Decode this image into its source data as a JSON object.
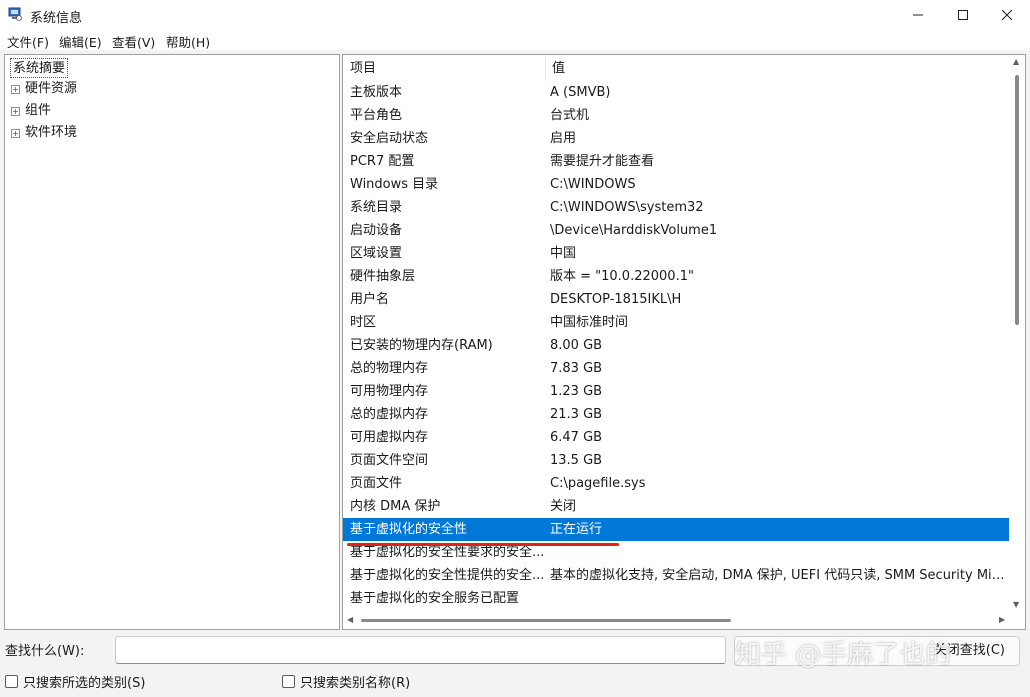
{
  "window": {
    "title": "系统信息",
    "min": "—",
    "max": "☐",
    "close": "✕"
  },
  "menu": [
    "文件(F)",
    "编辑(E)",
    "查看(V)",
    "帮助(H)"
  ],
  "tree": {
    "root": "系统摘要",
    "children": [
      "硬件资源",
      "组件",
      "软件环境"
    ],
    "expander": "+"
  },
  "table": {
    "headers": {
      "item": "项目",
      "value": "值"
    },
    "rows": [
      {
        "item": "主板版本",
        "value": "A (SMVB)"
      },
      {
        "item": "平台角色",
        "value": "台式机"
      },
      {
        "item": "安全启动状态",
        "value": "启用"
      },
      {
        "item": "PCR7 配置",
        "value": "需要提升才能查看"
      },
      {
        "item": "Windows 目录",
        "value": "C:\\WINDOWS"
      },
      {
        "item": "系统目录",
        "value": "C:\\WINDOWS\\system32"
      },
      {
        "item": "启动设备",
        "value": "\\Device\\HarddiskVolume1"
      },
      {
        "item": "区域设置",
        "value": "中国"
      },
      {
        "item": "硬件抽象层",
        "value": "版本 = \"10.0.22000.1\""
      },
      {
        "item": "用户名",
        "value": "DESKTOP-1815IKL\\H"
      },
      {
        "item": "时区",
        "value": "中国标准时间"
      },
      {
        "item": "已安装的物理内存(RAM)",
        "value": "8.00 GB"
      },
      {
        "item": "总的物理内存",
        "value": "7.83 GB"
      },
      {
        "item": "可用物理内存",
        "value": "1.23 GB"
      },
      {
        "item": "总的虚拟内存",
        "value": "21.3 GB"
      },
      {
        "item": "可用虚拟内存",
        "value": "6.47 GB"
      },
      {
        "item": "页面文件空间",
        "value": "13.5 GB"
      },
      {
        "item": "页面文件",
        "value": "C:\\pagefile.sys"
      },
      {
        "item": "内核 DMA 保护",
        "value": "关闭"
      },
      {
        "item": "基于虚拟化的安全性",
        "value": "正在运行"
      },
      {
        "item": "基于虚拟化的安全性要求的安全...",
        "value": ""
      },
      {
        "item": "基于虚拟化的安全性提供的安全...",
        "value": "基本的虚拟化支持, 安全启动, DMA 保护, UEFI 代码只读, SMM Security Mitig."
      },
      {
        "item": "基于虚拟化的安全服务已配置",
        "value": ""
      }
    ],
    "selected_index": 19
  },
  "search": {
    "label": "查找什么(W):",
    "value": "",
    "find_button": "关闭查找(C)",
    "option1": "只搜索所选的类别(S)",
    "option2": "只搜索类别名称(R)"
  },
  "watermark": "知乎 @手麻了也的",
  "colors": {
    "selection": "#0078d7",
    "underline": "#e0221b"
  }
}
